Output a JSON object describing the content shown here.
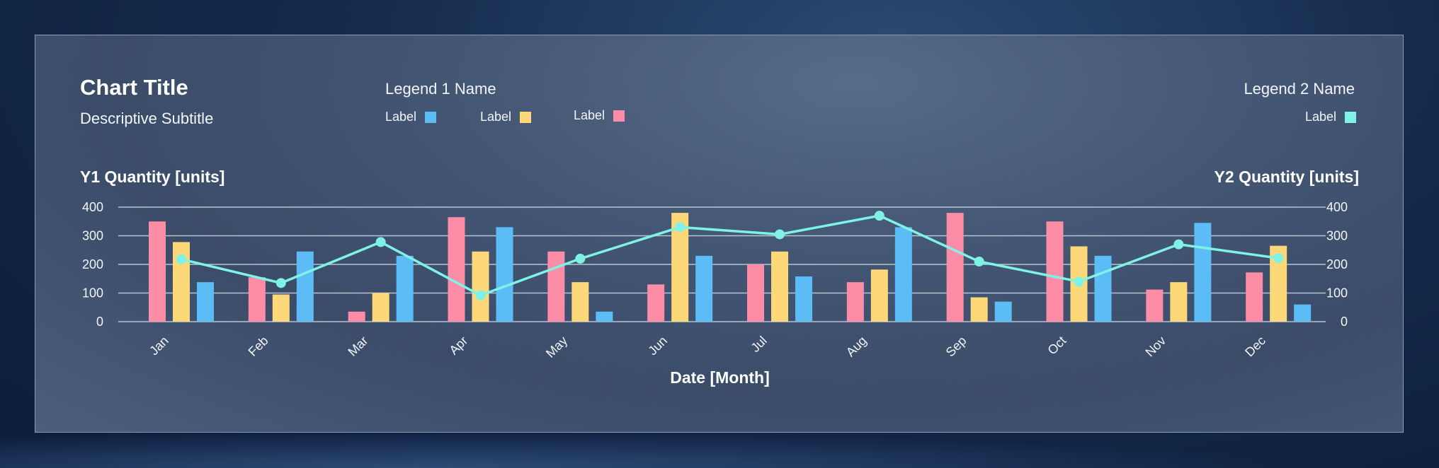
{
  "chart_data": {
    "type": "bar",
    "title": "Chart Title",
    "subtitle": "Descriptive Subtitle",
    "xlabel": "Date [Month]",
    "ylabel": "Y1 Quantity [units]",
    "y2label": "Y2 Quantity [units]",
    "categories": [
      "Jan",
      "Feb",
      "Mar",
      "Apr",
      "May",
      "Jun",
      "Jul",
      "Aug",
      "Sep",
      "Oct",
      "Nov",
      "Dec"
    ],
    "ylim": [
      0,
      400
    ],
    "y2lim": [
      0,
      400
    ],
    "yticks": [
      "0",
      "100",
      "200",
      "300",
      "400"
    ],
    "y2ticks": [
      "0",
      "100",
      "200",
      "300",
      "400"
    ],
    "grid": true,
    "legends": [
      {
        "name": "Legend 1 Name",
        "placement": "top-center",
        "entries": [
          {
            "label": "Label",
            "color": "#5cbcf6"
          },
          {
            "label": "Label",
            "color": "#fdd878"
          },
          {
            "label": "Label",
            "color": "#fd8ca6"
          }
        ]
      },
      {
        "name": "Legend 2 Name",
        "placement": "top-right",
        "entries": [
          {
            "label": "Label",
            "color": "#7ff2e6"
          }
        ]
      }
    ],
    "series": [
      {
        "type": "bar",
        "axis": "y1",
        "color": "#fd8ca6",
        "values": [
          350,
          155,
          35,
          365,
          245,
          130,
          200,
          138,
          380,
          350,
          112,
          172
        ]
      },
      {
        "type": "bar",
        "axis": "y1",
        "color": "#fdd878",
        "values": [
          278,
          95,
          100,
          245,
          138,
          380,
          245,
          182,
          85,
          263,
          138,
          265
        ]
      },
      {
        "type": "bar",
        "axis": "y1",
        "color": "#5cbcf6",
        "values": [
          138,
          245,
          230,
          330,
          35,
          230,
          158,
          330,
          70,
          230,
          345,
          60
        ]
      },
      {
        "type": "line",
        "axis": "y2",
        "color": "#7ff2e6",
        "values": [
          218,
          135,
          278,
          92,
          220,
          330,
          305,
          370,
          210,
          140,
          270,
          222
        ]
      }
    ]
  }
}
